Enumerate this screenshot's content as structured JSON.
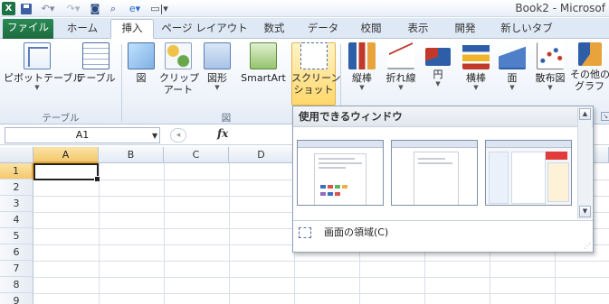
{
  "title_bar": {
    "app_icon": "X",
    "quick_access": [
      "save-icon",
      "undo-icon",
      "redo-icon",
      "camera-icon",
      "print-preview-icon",
      "ie-icon",
      "customize-icon"
    ],
    "title": "Book2 - Microsof"
  },
  "tabs": [
    {
      "label": "ファイル"
    },
    {
      "label": "ホーム"
    },
    {
      "label": "挿入"
    },
    {
      "label": "ページ レイアウト"
    },
    {
      "label": "数式"
    },
    {
      "label": "データ"
    },
    {
      "label": "校閲"
    },
    {
      "label": "表示"
    },
    {
      "label": "開発"
    },
    {
      "label": "新しいタブ"
    }
  ],
  "active_tab": "挿入",
  "ribbon": {
    "pivot": {
      "line1": "ピボットテーブル"
    },
    "table": {
      "line1": "テーブル"
    },
    "picture": {
      "line1": "図"
    },
    "clipart": {
      "line1": "クリップ",
      "line2": "アート"
    },
    "shapes": {
      "line1": "図形"
    },
    "smartart": {
      "line1": "SmartArt"
    },
    "screenshot": {
      "line1": "スクリーン",
      "line2": "ショット"
    },
    "column": {
      "line1": "縦棒"
    },
    "line": {
      "line1": "折れ線"
    },
    "pie": {
      "line1": "円"
    },
    "bar": {
      "line1": "横棒"
    },
    "area": {
      "line1": "面"
    },
    "scatter": {
      "line1": "散布図"
    },
    "other": {
      "line1": "その他の",
      "line2": "グラフ"
    },
    "group_tables": "テーブル",
    "group_illustrations": "図"
  },
  "formula_bar": {
    "name_box": "A1",
    "fx": "fx",
    "value": ""
  },
  "grid": {
    "columns": [
      "A",
      "B",
      "C",
      "D"
    ],
    "rows": [
      "1",
      "2",
      "3",
      "4",
      "5",
      "6",
      "7",
      "8",
      "9"
    ],
    "active_cell": "A1"
  },
  "screenshot_menu": {
    "header": "使用できるウィンドウ",
    "screen_clipping": "画面の領域(C)"
  }
}
